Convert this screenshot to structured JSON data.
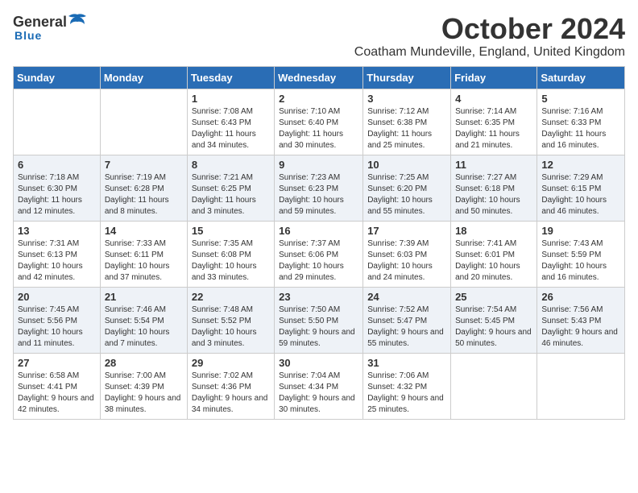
{
  "logo": {
    "general": "General",
    "blue": "Blue"
  },
  "header": {
    "month": "October 2024",
    "location": "Coatham Mundeville, England, United Kingdom"
  },
  "days_of_week": [
    "Sunday",
    "Monday",
    "Tuesday",
    "Wednesday",
    "Thursday",
    "Friday",
    "Saturday"
  ],
  "weeks": [
    [
      {
        "day": "",
        "info": ""
      },
      {
        "day": "",
        "info": ""
      },
      {
        "day": "1",
        "info": "Sunrise: 7:08 AM\nSunset: 6:43 PM\nDaylight: 11 hours and 34 minutes."
      },
      {
        "day": "2",
        "info": "Sunrise: 7:10 AM\nSunset: 6:40 PM\nDaylight: 11 hours and 30 minutes."
      },
      {
        "day": "3",
        "info": "Sunrise: 7:12 AM\nSunset: 6:38 PM\nDaylight: 11 hours and 25 minutes."
      },
      {
        "day": "4",
        "info": "Sunrise: 7:14 AM\nSunset: 6:35 PM\nDaylight: 11 hours and 21 minutes."
      },
      {
        "day": "5",
        "info": "Sunrise: 7:16 AM\nSunset: 6:33 PM\nDaylight: 11 hours and 16 minutes."
      }
    ],
    [
      {
        "day": "6",
        "info": "Sunrise: 7:18 AM\nSunset: 6:30 PM\nDaylight: 11 hours and 12 minutes."
      },
      {
        "day": "7",
        "info": "Sunrise: 7:19 AM\nSunset: 6:28 PM\nDaylight: 11 hours and 8 minutes."
      },
      {
        "day": "8",
        "info": "Sunrise: 7:21 AM\nSunset: 6:25 PM\nDaylight: 11 hours and 3 minutes."
      },
      {
        "day": "9",
        "info": "Sunrise: 7:23 AM\nSunset: 6:23 PM\nDaylight: 10 hours and 59 minutes."
      },
      {
        "day": "10",
        "info": "Sunrise: 7:25 AM\nSunset: 6:20 PM\nDaylight: 10 hours and 55 minutes."
      },
      {
        "day": "11",
        "info": "Sunrise: 7:27 AM\nSunset: 6:18 PM\nDaylight: 10 hours and 50 minutes."
      },
      {
        "day": "12",
        "info": "Sunrise: 7:29 AM\nSunset: 6:15 PM\nDaylight: 10 hours and 46 minutes."
      }
    ],
    [
      {
        "day": "13",
        "info": "Sunrise: 7:31 AM\nSunset: 6:13 PM\nDaylight: 10 hours and 42 minutes."
      },
      {
        "day": "14",
        "info": "Sunrise: 7:33 AM\nSunset: 6:11 PM\nDaylight: 10 hours and 37 minutes."
      },
      {
        "day": "15",
        "info": "Sunrise: 7:35 AM\nSunset: 6:08 PM\nDaylight: 10 hours and 33 minutes."
      },
      {
        "day": "16",
        "info": "Sunrise: 7:37 AM\nSunset: 6:06 PM\nDaylight: 10 hours and 29 minutes."
      },
      {
        "day": "17",
        "info": "Sunrise: 7:39 AM\nSunset: 6:03 PM\nDaylight: 10 hours and 24 minutes."
      },
      {
        "day": "18",
        "info": "Sunrise: 7:41 AM\nSunset: 6:01 PM\nDaylight: 10 hours and 20 minutes."
      },
      {
        "day": "19",
        "info": "Sunrise: 7:43 AM\nSunset: 5:59 PM\nDaylight: 10 hours and 16 minutes."
      }
    ],
    [
      {
        "day": "20",
        "info": "Sunrise: 7:45 AM\nSunset: 5:56 PM\nDaylight: 10 hours and 11 minutes."
      },
      {
        "day": "21",
        "info": "Sunrise: 7:46 AM\nSunset: 5:54 PM\nDaylight: 10 hours and 7 minutes."
      },
      {
        "day": "22",
        "info": "Sunrise: 7:48 AM\nSunset: 5:52 PM\nDaylight: 10 hours and 3 minutes."
      },
      {
        "day": "23",
        "info": "Sunrise: 7:50 AM\nSunset: 5:50 PM\nDaylight: 9 hours and 59 minutes."
      },
      {
        "day": "24",
        "info": "Sunrise: 7:52 AM\nSunset: 5:47 PM\nDaylight: 9 hours and 55 minutes."
      },
      {
        "day": "25",
        "info": "Sunrise: 7:54 AM\nSunset: 5:45 PM\nDaylight: 9 hours and 50 minutes."
      },
      {
        "day": "26",
        "info": "Sunrise: 7:56 AM\nSunset: 5:43 PM\nDaylight: 9 hours and 46 minutes."
      }
    ],
    [
      {
        "day": "27",
        "info": "Sunrise: 6:58 AM\nSunset: 4:41 PM\nDaylight: 9 hours and 42 minutes."
      },
      {
        "day": "28",
        "info": "Sunrise: 7:00 AM\nSunset: 4:39 PM\nDaylight: 9 hours and 38 minutes."
      },
      {
        "day": "29",
        "info": "Sunrise: 7:02 AM\nSunset: 4:36 PM\nDaylight: 9 hours and 34 minutes."
      },
      {
        "day": "30",
        "info": "Sunrise: 7:04 AM\nSunset: 4:34 PM\nDaylight: 9 hours and 30 minutes."
      },
      {
        "day": "31",
        "info": "Sunrise: 7:06 AM\nSunset: 4:32 PM\nDaylight: 9 hours and 25 minutes."
      },
      {
        "day": "",
        "info": ""
      },
      {
        "day": "",
        "info": ""
      }
    ]
  ]
}
